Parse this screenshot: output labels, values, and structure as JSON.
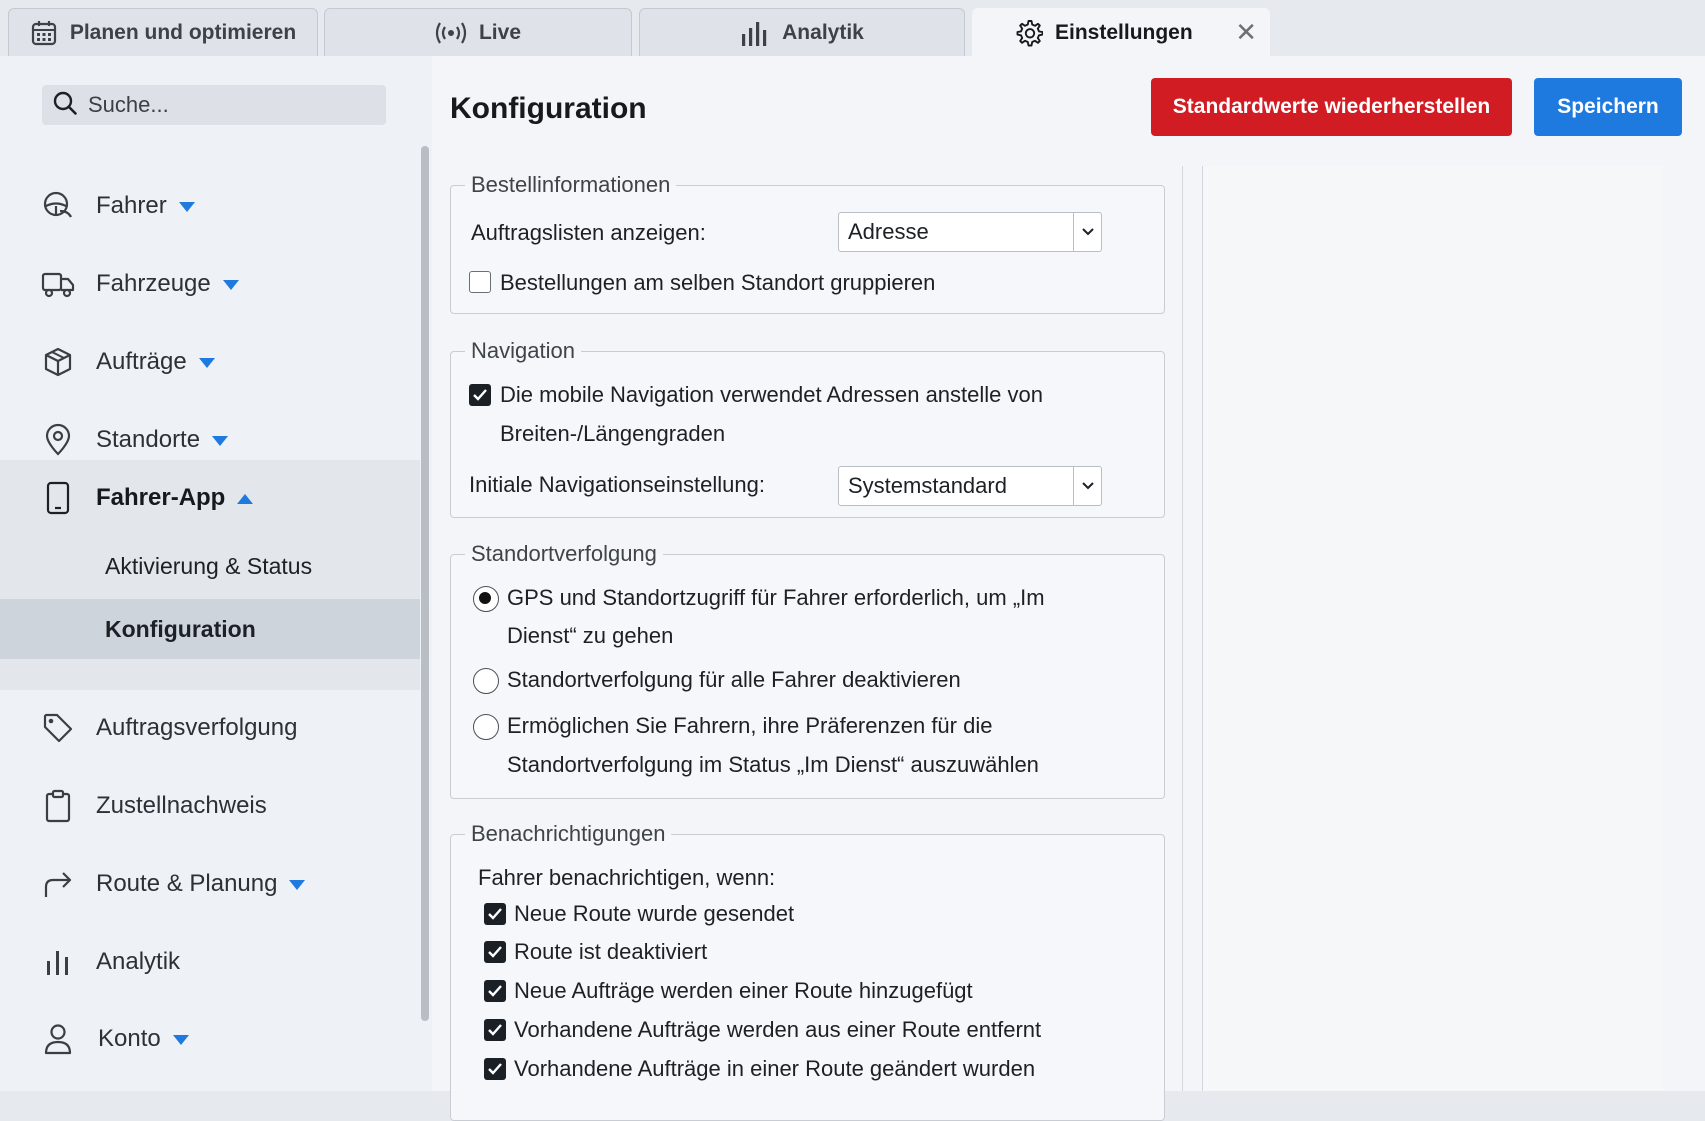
{
  "tabs": [
    {
      "label": "Planen und optimieren",
      "icon": "calendar-icon"
    },
    {
      "label": "Live",
      "icon": "broadcast-icon"
    },
    {
      "label": "Analytik",
      "icon": "bar-chart-icon"
    },
    {
      "label": "Einstellungen",
      "icon": "gear-icon",
      "active": true,
      "close": "✕"
    }
  ],
  "sidebar": {
    "search_placeholder": "Suche...",
    "items": [
      {
        "label": "Fahrer",
        "icon": "steering-wheel-icon",
        "expandable": true
      },
      {
        "label": "Fahrzeuge",
        "icon": "truck-icon",
        "expandable": true
      },
      {
        "label": "Aufträge",
        "icon": "package-icon",
        "expandable": true
      },
      {
        "label": "Standorte",
        "icon": "map-pin-icon",
        "expandable": true
      },
      {
        "label": "Fahrer-App",
        "icon": "phone-icon",
        "expanded": true
      },
      {
        "label": "Auftragsverfolgung",
        "icon": "tag-icon"
      },
      {
        "label": "Zustellnachweis",
        "icon": "clipboard-icon"
      },
      {
        "label": "Route & Planung",
        "icon": "route-arrow-icon",
        "expandable": true
      },
      {
        "label": "Analytik",
        "icon": "bar-chart-icon"
      },
      {
        "label": "Konto",
        "icon": "user-icon",
        "expandable": true
      }
    ],
    "sub_items": [
      {
        "label": "Aktivierung & Status"
      },
      {
        "label": "Konfiguration",
        "selected": true
      }
    ]
  },
  "main": {
    "title": "Konfiguration",
    "reset_label": "Standardwerte wiederherstellen",
    "save_label": "Speichern",
    "colors": {
      "reset": "#d21c23",
      "save": "#1f7ae0",
      "accent": "#1f7ae0"
    }
  },
  "orders": {
    "legend": "Bestellinformationen",
    "list_label": "Auftragslisten anzeigen:",
    "list_value": "Adresse",
    "group_label": "Bestellungen am selben Standort gruppieren",
    "group_checked": false
  },
  "navigation": {
    "legend": "Navigation",
    "address_label_1": "Die mobile Navigation verwendet Adressen anstelle von",
    "address_label_2": "Breiten-/Längengraden",
    "address_checked": true,
    "initial_label": "Initiale Navigationseinstellung:",
    "initial_value": "Systemstandard"
  },
  "tracking": {
    "legend": "Standortverfolgung",
    "options": [
      {
        "line1": "GPS und Standortzugriff für Fahrer erforderlich, um „Im",
        "line2": "Dienst“ zu gehen",
        "selected": true
      },
      {
        "line1": "Standortverfolgung für alle Fahrer deaktivieren",
        "line2": "",
        "selected": false
      },
      {
        "line1": "Ermöglichen Sie Fahrern, ihre Präferenzen für die",
        "line2": "Standortverfolgung im Status „Im Dienst“ auszuwählen",
        "selected": false
      }
    ]
  },
  "notifications": {
    "legend": "Benachrichtigungen",
    "intro": "Fahrer benachrichtigen, wenn:",
    "items": [
      {
        "label": "Neue Route wurde gesendet",
        "checked": true
      },
      {
        "label": "Route ist deaktiviert",
        "checked": true
      },
      {
        "label": "Neue Aufträge werden einer Route hinzugefügt",
        "checked": true
      },
      {
        "label": "Vorhandene Aufträge werden aus einer Route entfernt",
        "checked": true
      },
      {
        "label": "Vorhandene Aufträge in einer Route geändert wurden",
        "checked": true
      }
    ]
  }
}
